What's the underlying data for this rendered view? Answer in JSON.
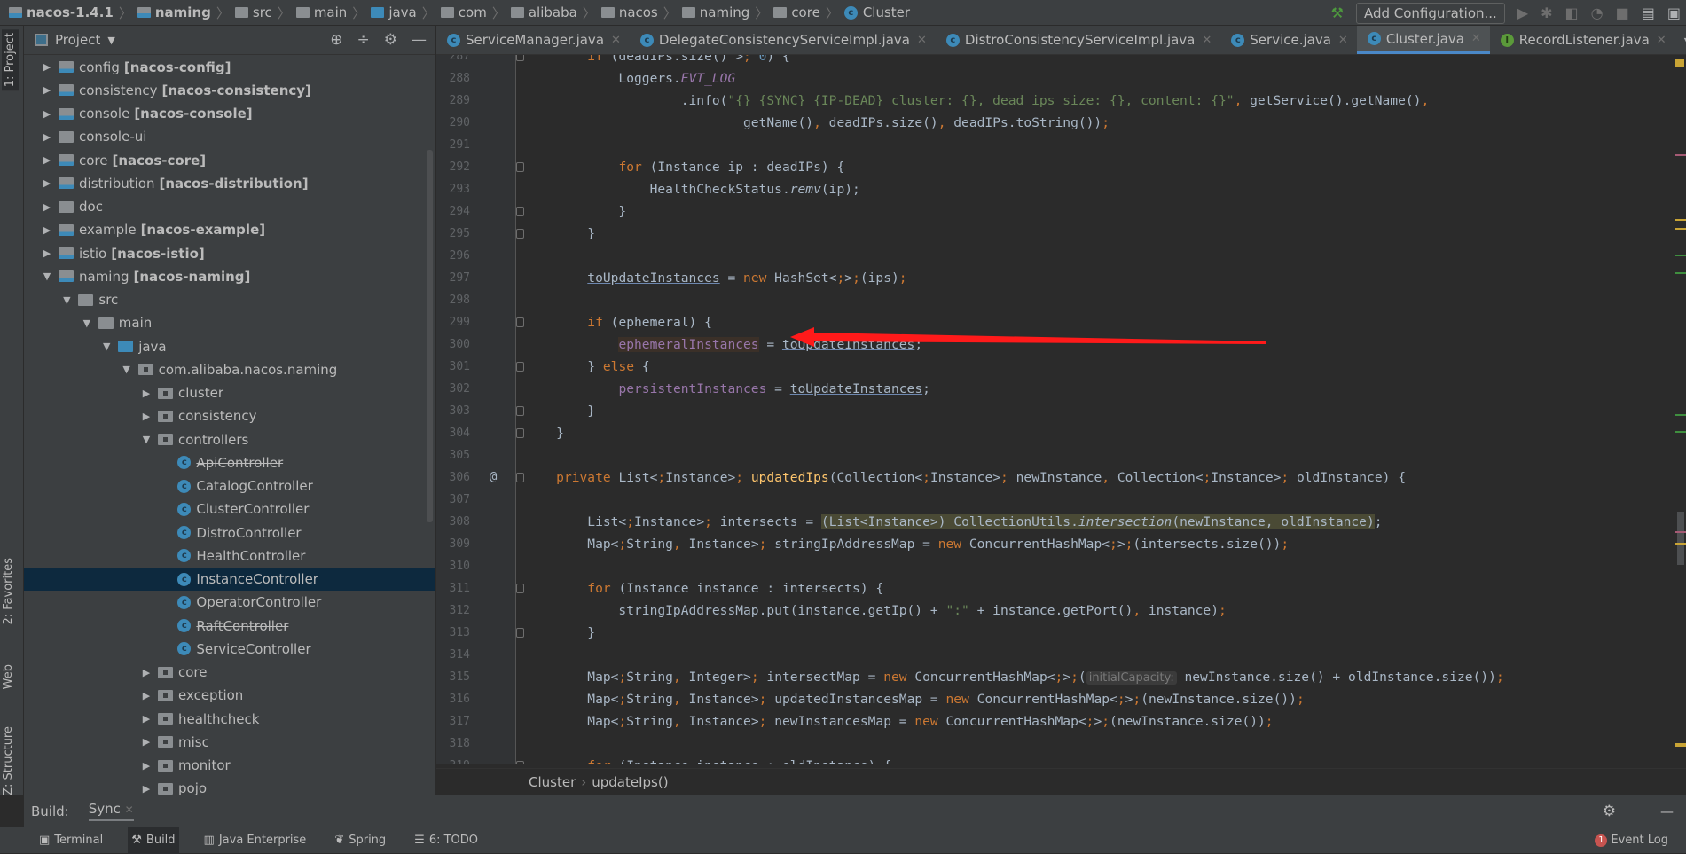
{
  "breadcrumb": [
    {
      "label": "nacos-1.4.1",
      "icon": "module",
      "bold": true
    },
    {
      "label": "naming",
      "icon": "module",
      "bold": true
    },
    {
      "label": "src",
      "icon": "folder"
    },
    {
      "label": "main",
      "icon": "folder"
    },
    {
      "label": "java",
      "icon": "source-folder"
    },
    {
      "label": "com",
      "icon": "package"
    },
    {
      "label": "alibaba",
      "icon": "package"
    },
    {
      "label": "nacos",
      "icon": "package"
    },
    {
      "label": "naming",
      "icon": "package"
    },
    {
      "label": "core",
      "icon": "package"
    },
    {
      "label": "Cluster",
      "icon": "class"
    }
  ],
  "toolbar": {
    "add_configuration": "Add Configuration..."
  },
  "left_strip": {
    "project": "1: Project",
    "favorites": "2: Favorites",
    "web": "Web",
    "structure": "Z: Structure"
  },
  "project_panel": {
    "title": "Project",
    "tree": [
      {
        "name": "config",
        "module": "[nacos-config]",
        "level": 0,
        "icon": "module",
        "state": "collapsed"
      },
      {
        "name": "consistency",
        "module": "[nacos-consistency]",
        "level": 0,
        "icon": "module",
        "state": "collapsed"
      },
      {
        "name": "console",
        "module": "[nacos-console]",
        "level": 0,
        "icon": "module",
        "state": "collapsed"
      },
      {
        "name": "console-ui",
        "level": 0,
        "icon": "folder",
        "state": "collapsed"
      },
      {
        "name": "core",
        "module": "[nacos-core]",
        "level": 0,
        "icon": "module",
        "state": "collapsed"
      },
      {
        "name": "distribution",
        "module": "[nacos-distribution]",
        "level": 0,
        "icon": "module",
        "state": "collapsed"
      },
      {
        "name": "doc",
        "level": 0,
        "icon": "folder",
        "state": "collapsed"
      },
      {
        "name": "example",
        "module": "[nacos-example]",
        "level": 0,
        "icon": "module",
        "state": "collapsed"
      },
      {
        "name": "istio",
        "module": "[nacos-istio]",
        "level": 0,
        "icon": "module",
        "state": "collapsed"
      },
      {
        "name": "naming",
        "module": "[nacos-naming]",
        "level": 0,
        "icon": "module",
        "state": "expanded"
      },
      {
        "name": "src",
        "level": 1,
        "icon": "folder",
        "state": "expanded"
      },
      {
        "name": "main",
        "level": 2,
        "icon": "folder",
        "state": "expanded"
      },
      {
        "name": "java",
        "level": 3,
        "icon": "source-folder",
        "state": "expanded"
      },
      {
        "name": "com.alibaba.nacos.naming",
        "level": 4,
        "icon": "package",
        "state": "expanded"
      },
      {
        "name": "cluster",
        "level": 5,
        "icon": "package",
        "state": "collapsed"
      },
      {
        "name": "consistency",
        "level": 5,
        "icon": "package",
        "state": "collapsed"
      },
      {
        "name": "controllers",
        "level": 5,
        "icon": "package",
        "state": "expanded"
      },
      {
        "name": "ApiController",
        "level": 6,
        "icon": "class",
        "deprecated": true
      },
      {
        "name": "CatalogController",
        "level": 6,
        "icon": "class"
      },
      {
        "name": "ClusterController",
        "level": 6,
        "icon": "class"
      },
      {
        "name": "DistroController",
        "level": 6,
        "icon": "class"
      },
      {
        "name": "HealthController",
        "level": 6,
        "icon": "class"
      },
      {
        "name": "InstanceController",
        "level": 6,
        "icon": "class",
        "selected": true
      },
      {
        "name": "OperatorController",
        "level": 6,
        "icon": "class"
      },
      {
        "name": "RaftController",
        "level": 6,
        "icon": "class",
        "deprecated": true
      },
      {
        "name": "ServiceController",
        "level": 6,
        "icon": "class"
      },
      {
        "name": "core",
        "level": 5,
        "icon": "package",
        "state": "collapsed"
      },
      {
        "name": "exception",
        "level": 5,
        "icon": "package",
        "state": "collapsed"
      },
      {
        "name": "healthcheck",
        "level": 5,
        "icon": "package",
        "state": "collapsed"
      },
      {
        "name": "misc",
        "level": 5,
        "icon": "package",
        "state": "collapsed"
      },
      {
        "name": "monitor",
        "level": 5,
        "icon": "package",
        "state": "collapsed"
      },
      {
        "name": "pojo",
        "level": 5,
        "icon": "package",
        "state": "collapsed"
      }
    ]
  },
  "tabs": [
    {
      "label": "ServiceManager.java",
      "icon": "class"
    },
    {
      "label": "DelegateConsistencyServiceImpl.java",
      "icon": "class"
    },
    {
      "label": "DistroConsistencyServiceImpl.java",
      "icon": "class"
    },
    {
      "label": "Service.java",
      "icon": "class"
    },
    {
      "label": "Cluster.java",
      "icon": "class",
      "active": true
    },
    {
      "label": "RecordListener.java",
      "icon": "interface"
    }
  ],
  "tabs_overflow": "3",
  "code": [
    {
      "n": "287",
      "fold": true,
      "t": [
        [
          "        "
        ],
        [
          "if",
          "kw"
        ],
        [
          " (deadIPs.size() > "
        ],
        [
          "0",
          "num"
        ],
        [
          ") {"
        ]
      ]
    },
    {
      "n": "288",
      "t": [
        [
          "            Loggers."
        ],
        [
          "EVT_LOG",
          "fld it"
        ]
      ]
    },
    {
      "n": "289",
      "t": [
        [
          "                    .info("
        ],
        [
          "\"{} {SYNC} {IP-DEAD} cluster: {}, dead ips size: {}, content: {}\"",
          "str"
        ],
        [
          ", getService().getName(),"
        ]
      ]
    },
    {
      "n": "290",
      "t": [
        [
          "                            getName(), deadIPs.size(), deadIPs.toString());"
        ]
      ]
    },
    {
      "n": "291",
      "t": []
    },
    {
      "n": "292",
      "fold": true,
      "t": [
        [
          "            "
        ],
        [
          "for",
          "kw"
        ],
        [
          " (Instance ip : deadIPs) {"
        ]
      ]
    },
    {
      "n": "293",
      "t": [
        [
          "                HealthCheckStatus."
        ],
        [
          "remv",
          "it"
        ],
        [
          "(ip);"
        ]
      ]
    },
    {
      "n": "294",
      "fold": true,
      "t": [
        [
          "            }"
        ]
      ]
    },
    {
      "n": "295",
      "fold": true,
      "t": [
        [
          "        }"
        ]
      ]
    },
    {
      "n": "296",
      "t": []
    },
    {
      "n": "297",
      "t": [
        [
          "        "
        ],
        [
          "toUpdateInstances",
          "ul"
        ],
        [
          " = "
        ],
        [
          "new",
          "kw"
        ],
        [
          " HashSet<>(ips);"
        ]
      ]
    },
    {
      "n": "298",
      "t": []
    },
    {
      "n": "299",
      "fold": true,
      "t": [
        [
          "        "
        ],
        [
          "if",
          "kw"
        ],
        [
          " (ephemeral) {"
        ]
      ]
    },
    {
      "n": "300",
      "t": [
        [
          "            "
        ],
        [
          "ephemeralInstances",
          "fld hl"
        ],
        [
          " = "
        ],
        [
          "toUpdateInstances",
          "ul"
        ],
        [
          ";"
        ]
      ]
    },
    {
      "n": "301",
      "fold": true,
      "t": [
        [
          "        } "
        ],
        [
          "else",
          "kw"
        ],
        [
          " {"
        ]
      ]
    },
    {
      "n": "302",
      "t": [
        [
          "            "
        ],
        [
          "persistentInstances",
          "fld"
        ],
        [
          " = "
        ],
        [
          "toUpdateInstances",
          "ul"
        ],
        [
          ";"
        ]
      ]
    },
    {
      "n": "303",
      "fold": true,
      "t": [
        [
          "        }"
        ]
      ]
    },
    {
      "n": "304",
      "fold": true,
      "t": [
        [
          "    }"
        ]
      ]
    },
    {
      "n": "305",
      "t": []
    },
    {
      "n": "306",
      "fold": true,
      "annotation": "@",
      "t": [
        [
          "    "
        ],
        [
          "private",
          "kw"
        ],
        [
          " List<Instance> "
        ],
        [
          "updatedIps",
          "fn"
        ],
        [
          "(Collection<Instance> newInstance, Collection<Instance> oldInstance) {"
        ]
      ]
    },
    {
      "n": "307",
      "t": []
    },
    {
      "n": "308",
      "t": [
        [
          "        List<Instance> intersects = "
        ],
        [
          "(List<Instance>) CollectionUtils.",
          "hl2"
        ],
        [
          "intersection",
          "hl2 it"
        ],
        [
          "(newInstance, oldInstance)",
          "hl2"
        ],
        [
          ";"
        ]
      ]
    },
    {
      "n": "309",
      "t": [
        [
          "        Map<String, Instance> stringIpAddressMap = "
        ],
        [
          "new",
          "kw"
        ],
        [
          " ConcurrentHashMap<>(intersects.size());"
        ]
      ]
    },
    {
      "n": "310",
      "t": []
    },
    {
      "n": "311",
      "fold": true,
      "t": [
        [
          "        "
        ],
        [
          "for",
          "kw"
        ],
        [
          " (Instance instance : intersects) {"
        ]
      ]
    },
    {
      "n": "312",
      "t": [
        [
          "            stringIpAddressMap.put(instance.getIp() + "
        ],
        [
          "\":\"",
          "str"
        ],
        [
          " + instance.getPort(), instance);"
        ]
      ]
    },
    {
      "n": "313",
      "fold": true,
      "t": [
        [
          "        }"
        ]
      ]
    },
    {
      "n": "314",
      "t": []
    },
    {
      "n": "315",
      "t": [
        [
          "        Map<String, Integer> intersectMap = "
        ],
        [
          "new",
          "kw"
        ],
        [
          " ConcurrentHashMap<>("
        ],
        [
          "initialCapacity:",
          "hint"
        ],
        [
          " newInstance.size() + oldInstance.size());"
        ]
      ]
    },
    {
      "n": "316",
      "t": [
        [
          "        Map<String, Instance> updatedInstancesMap = "
        ],
        [
          "new",
          "kw"
        ],
        [
          " ConcurrentHashMap<>(newInstance.size());"
        ]
      ]
    },
    {
      "n": "317",
      "t": [
        [
          "        Map<String, Instance> newInstancesMap = "
        ],
        [
          "new",
          "kw"
        ],
        [
          " ConcurrentHashMap<>(newInstance.size());"
        ]
      ]
    },
    {
      "n": "318",
      "t": []
    },
    {
      "n": "319",
      "fold": true,
      "t": [
        [
          "        "
        ],
        [
          "for",
          "kw"
        ],
        [
          " (Instance instance : oldInstance) {"
        ]
      ]
    }
  ],
  "editor_breadcrumb": {
    "class": "Cluster",
    "method": "updateIps()"
  },
  "build_bar": {
    "label": "Build:",
    "tab": "Sync"
  },
  "bottom_tools": [
    {
      "label": "Terminal",
      "icon": "terminal-icon"
    },
    {
      "label": "Build",
      "icon": "hammer-icon",
      "active": true
    },
    {
      "label": "Java Enterprise",
      "icon": "java-enterprise-icon"
    },
    {
      "label": "Spring",
      "icon": "spring-icon"
    },
    {
      "label": "6: TODO",
      "icon": "todo-icon"
    }
  ],
  "event_log": {
    "label": "Event Log",
    "count": "1"
  },
  "colors": {
    "panel": "#3C3F41",
    "editor": "#2B2B2B",
    "accent": "#4A88C7",
    "selection": "#0D293E",
    "annotation_arrow": "#FF1A1A"
  }
}
